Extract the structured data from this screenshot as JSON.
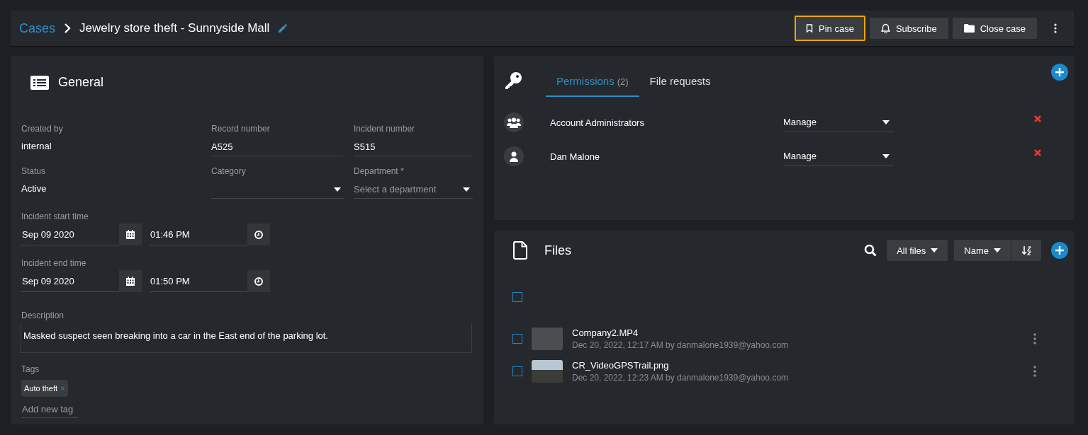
{
  "header": {
    "breadcrumb": "Cases",
    "title": "Jewelry store theft - Sunnyside Mall",
    "actions": [
      {
        "kind": "pin",
        "label": "Pin case",
        "focused": true
      },
      {
        "kind": "subscribe",
        "label": "Subscribe",
        "focused": false
      },
      {
        "kind": "close",
        "label": "Close case",
        "focused": false
      }
    ]
  },
  "general": {
    "title": "General",
    "fields": [
      {
        "kind": "static",
        "label": "Created by",
        "value": "internal"
      },
      {
        "kind": "input",
        "label": "Record number",
        "value": "A525"
      },
      {
        "kind": "input",
        "label": "Incident number",
        "value": "S515"
      },
      {
        "kind": "static",
        "label": "Status",
        "value": "Active"
      },
      {
        "kind": "select",
        "label": "Category"
      },
      {
        "kind": "select",
        "label": "Department *",
        "placeholder": "Select a department"
      }
    ],
    "times": [
      {
        "label": "Incident start time",
        "date": "Sep 09 2020",
        "time": "01:46 PM"
      },
      {
        "label": "Incident end time",
        "date": "Sep 09 2020",
        "time": "01:50 PM"
      }
    ],
    "description": {
      "label": "Description",
      "value": "Masked suspect seen breaking into a car in the East end of the parking lot."
    },
    "tags": {
      "label": "Tags",
      "items": [
        "Auto theft"
      ],
      "remove": "×",
      "placeholder": "Add new tag"
    }
  },
  "permissions": {
    "tabs": [
      {
        "label": "Permissions",
        "count": "(2)",
        "selected": true
      },
      {
        "label": "File requests",
        "selected": false
      }
    ],
    "entries": [
      {
        "kind": "group",
        "name": "Account Administrators",
        "role": "Manage"
      },
      {
        "kind": "user",
        "name": "Dan Malone",
        "role": "Manage"
      }
    ]
  },
  "files": {
    "title": "Files",
    "filter": "All files",
    "sort": "Name",
    "select_all_checked": false,
    "items": [
      {
        "name": "Company2.MP4",
        "meta": "Dec 20, 2022, 12:17 AM by danmalone1939@yahoo.com",
        "kind": "video",
        "checked": false
      },
      {
        "name": "CR_VideoGPSTrail.png",
        "meta": "Dec 20, 2022, 12:23 AM by danmalone1939@yahoo.com",
        "kind": "photo",
        "checked": false
      }
    ]
  }
}
